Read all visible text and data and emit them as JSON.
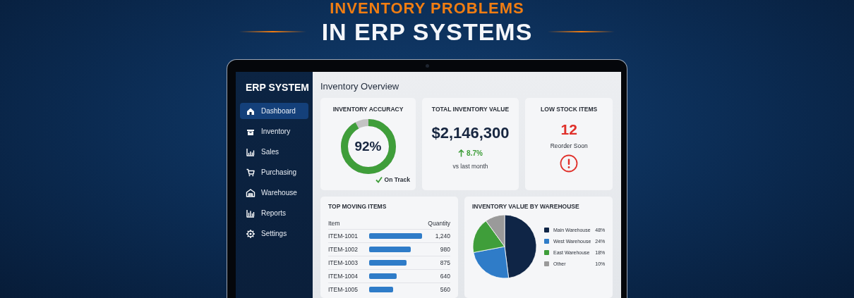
{
  "headline": {
    "line_1": "INVENTORY PROBLEMS",
    "line_2": "IN ERP SYSTEMS"
  },
  "sidebar": {
    "title": "ERP SYSTEM",
    "items": [
      {
        "label": "Dashboard",
        "selected": true
      },
      {
        "label": "Inventory",
        "selected": false
      },
      {
        "label": "Sales",
        "selected": false
      },
      {
        "label": "Purchasing",
        "selected": false
      },
      {
        "label": "Warehouse",
        "selected": false
      },
      {
        "label": "Reports",
        "selected": false
      },
      {
        "label": "Settings",
        "selected": false
      }
    ]
  },
  "page_title": "Inventory Overview",
  "accuracy_card": {
    "title": "INVENTORY ACCURACY",
    "level": 0.92,
    "value": "92%",
    "status": "On Track"
  },
  "value_card": {
    "title": "TOTAL INVENTORY VALUE",
    "value": "$2,146,300",
    "change": "8.7%",
    "comparison": "vs last month"
  },
  "low_stock_card": {
    "title": "LOW STOCK ITEMS",
    "count": "12",
    "note": "Reorder Soon"
  },
  "top_moving": {
    "title": "TOP MOVING ITEMS",
    "columns": [
      "Item",
      "Quantity"
    ],
    "rows": [
      {
        "item": "ITEM-1001",
        "quantity": "1,240"
      },
      {
        "item": "ITEM-1002",
        "quantity": "980"
      },
      {
        "item": "ITEM-1003",
        "quantity": "875"
      },
      {
        "item": "ITEM-1004",
        "quantity": "640"
      },
      {
        "item": "ITEM-1005",
        "quantity": "560"
      }
    ]
  },
  "warehouse_value": {
    "chart_data": {
      "type": "pie",
      "title": "INVENTORY VALUE BY WAREHOUSE",
      "categories": [
        "Main Warehouse",
        "West Warehouse",
        "East Warehouse",
        "Other"
      ],
      "values": [
        48,
        24,
        18,
        10
      ]
    },
    "legend": [
      {
        "value": "48%",
        "color": "#0f2546"
      },
      {
        "value": "24%",
        "color": "#2f7cc8"
      },
      {
        "value": "18%",
        "color": "#3f9e3a"
      },
      {
        "value": "10%",
        "color": "#9a9a9a"
      }
    ]
  }
}
